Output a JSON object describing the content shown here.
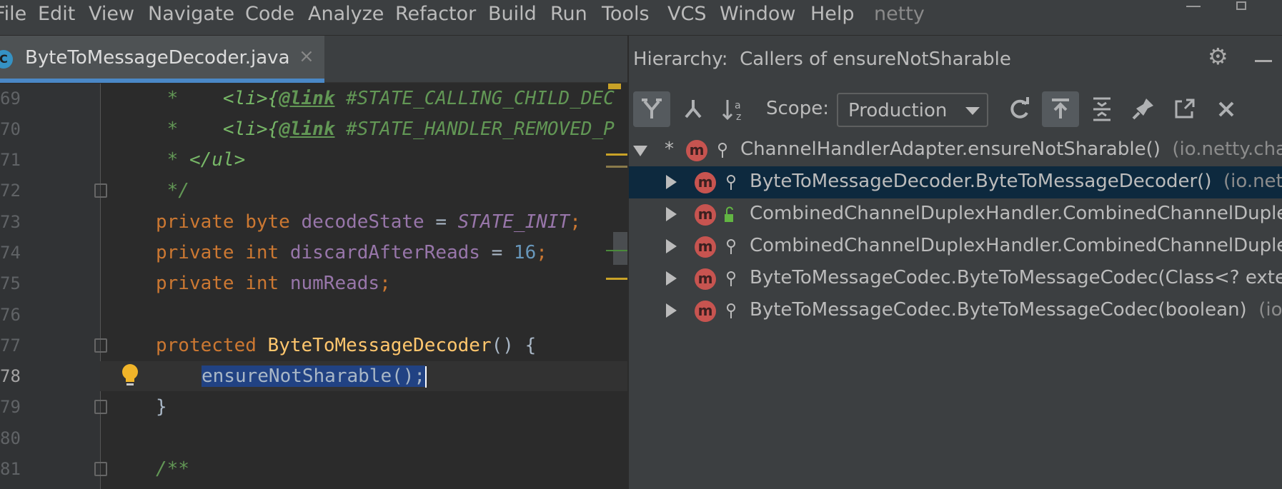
{
  "menu": {
    "items": [
      "File",
      "Edit",
      "View",
      "Navigate",
      "Code",
      "Analyze",
      "Refactor",
      "Build",
      "Run",
      "Tools",
      "VCS",
      "Window",
      "Help"
    ],
    "project": "netty"
  },
  "editor": {
    "tab": {
      "icon": "C",
      "label": "ByteToMessageDecoder.java",
      "close": "×"
    },
    "line_numbers": [
      "69",
      "70",
      "71",
      "72",
      "73",
      "74",
      "75",
      "76",
      "77",
      "78",
      "79",
      "80",
      "81"
    ],
    "lines": {
      "l69": {
        "star": " *    ",
        "tag": "<li>{",
        "link": "@link",
        "rest": " #STATE_CALLING_CHILD_DEC"
      },
      "l70": {
        "star": " *    ",
        "tag": "<li>{",
        "link": "@link",
        "rest": " #STATE_HANDLER_REMOVED_P"
      },
      "l71": {
        "star": " * ",
        "tag": "</ul>"
      },
      "l72": {
        "text": " */"
      },
      "l73": {
        "kw": "private byte ",
        "field": "decodeState",
        "op": " = ",
        "const": "STATE_INIT",
        "end": ";"
      },
      "l74": {
        "kw": "private int ",
        "field": "discardAfterReads",
        "op": " = ",
        "num": "16",
        "end": ";"
      },
      "l75": {
        "kw": "private int ",
        "field": "numReads",
        "end": ";"
      },
      "l77": {
        "kw": "protected ",
        "fn": "ByteToMessageDecoder",
        "rest": "() {"
      },
      "l78": {
        "selected": "ensureNotSharable()",
        "semi": ";"
      },
      "l79": {
        "text": "}"
      },
      "l81": {
        "text": "/**"
      }
    }
  },
  "hierarchy": {
    "title_prefix": "Hierarchy:",
    "title": "Callers of ensureNotSharable",
    "scope_label": "Scope:",
    "scope_value": "Production",
    "toolbar_icons": [
      "caller-hierarchy-icon",
      "callee-hierarchy-icon",
      "sort-alphabetically-icon",
      "refresh-icon",
      "export-icon",
      "expand-all-icon",
      "pin-icon",
      "open-in-window-icon",
      "close-icon"
    ],
    "tree": [
      {
        "expanded": true,
        "star": "*",
        "icon": "m",
        "name": "ChannelHandlerAdapter.ensureNotSharable()",
        "pkg": "(io.netty.cha"
      },
      {
        "expanded": false,
        "icon": "m",
        "name": "ByteToMessageDecoder.ByteToMessageDecoder()",
        "pkg": "(io.net",
        "selected": true
      },
      {
        "expanded": false,
        "icon": "m",
        "name": "CombinedChannelDuplexHandler.CombinedChannelDuple",
        "pkg": ""
      },
      {
        "expanded": false,
        "icon": "m",
        "name": "CombinedChannelDuplexHandler.CombinedChannelDuple",
        "pkg": ""
      },
      {
        "expanded": false,
        "icon": "m",
        "name": "ByteToMessageCodec.ByteToMessageCodec(Class<? exte",
        "pkg": ""
      },
      {
        "expanded": false,
        "icon": "m",
        "name": "ByteToMessageCodec.ByteToMessageCodec(boolean)",
        "pkg": "(io"
      }
    ]
  },
  "colors": {
    "selection": "#214283",
    "tree_selection": "#0d293e",
    "method_icon": "#c75450",
    "tab_underline": "#4a88c7"
  }
}
